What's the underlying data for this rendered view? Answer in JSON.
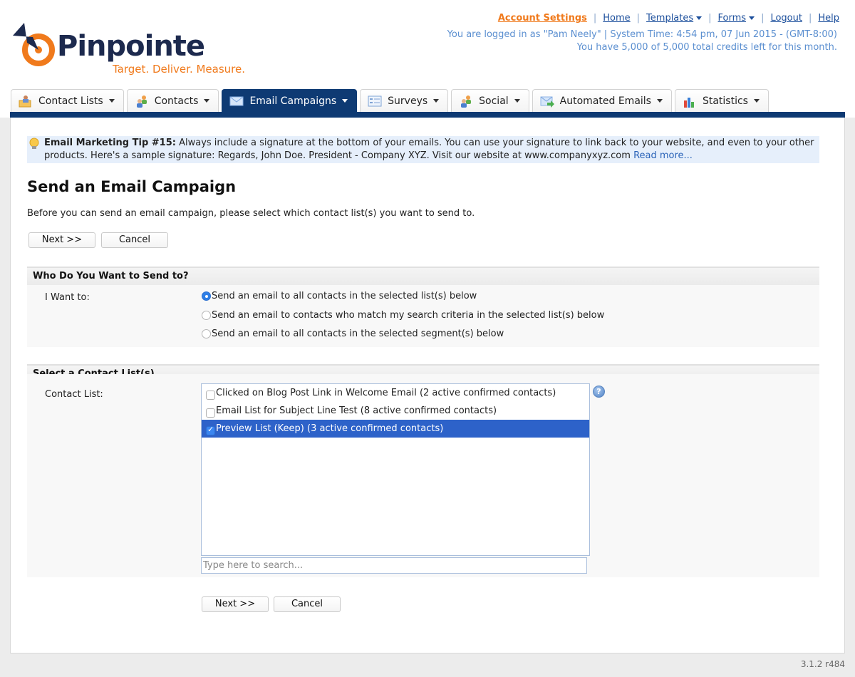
{
  "brand": {
    "name": "Pinpointe",
    "tagline": "Target. Deliver. Measure."
  },
  "toplinks": {
    "account_settings": "Account Settings",
    "home": "Home",
    "templates": "Templates",
    "forms": "Forms",
    "logout": "Logout",
    "help": "Help",
    "separator": "|"
  },
  "session": {
    "logged_in": "You are logged in as \"Pam Neely\" | System Time: 4:54 pm, 07 Jun 2015 - (GMT-8:00)",
    "credits": "You have 5,000 of 5,000 total credits left for this month."
  },
  "tabs": [
    {
      "label": "Contact Lists",
      "icon": "contact-lists-icon",
      "active": false
    },
    {
      "label": "Contacts",
      "icon": "contacts-icon",
      "active": false
    },
    {
      "label": "Email Campaigns",
      "icon": "envelope-icon",
      "active": true
    },
    {
      "label": "Surveys",
      "icon": "survey-form-icon",
      "active": false
    },
    {
      "label": "Social",
      "icon": "social-people-icon",
      "active": false
    },
    {
      "label": "Automated Emails",
      "icon": "automated-email-icon",
      "active": false
    },
    {
      "label": "Statistics",
      "icon": "bar-chart-icon",
      "active": false
    }
  ],
  "tip": {
    "title": "Email Marketing Tip #15:",
    "body": " Always include a signature at the bottom of your emails. You can use your signature to link back to your website, and even to your other products. Here's a sample signature: Regards, John Doe. President - Company XYZ. Visit our website at www.companyxyz.com ",
    "read_more": "Read more..."
  },
  "page": {
    "title": "Send an Email Campaign",
    "intro": "Before you can send an email campaign, please select which contact list(s) you want to send to."
  },
  "buttons": {
    "next": "Next >>",
    "cancel": "Cancel"
  },
  "who_section": {
    "heading": "Who Do You Want to Send to?",
    "label": "I Want to:",
    "options": [
      {
        "label": "Send an email to all contacts in the selected list(s) below",
        "checked": true
      },
      {
        "label": "Send an email to contacts who match my search criteria in the selected list(s) below",
        "checked": false
      },
      {
        "label": "Send an email to all contacts in the selected segment(s) below",
        "checked": false
      }
    ]
  },
  "list_section": {
    "heading": "Select a Contact List(s)",
    "label": "Contact List:",
    "items": [
      {
        "label": "Clicked on Blog Post Link in Welcome Email (2 active confirmed contacts)",
        "checked": false
      },
      {
        "label": "Email List for Subject Line Test (8 active confirmed contacts)",
        "checked": false
      },
      {
        "label": "Preview List (Keep) (3 active confirmed contacts)",
        "checked": true
      }
    ],
    "search_placeholder": "Type here to search...",
    "help_glyph": "?"
  },
  "footer": {
    "version": "3.1.2 r484"
  }
}
